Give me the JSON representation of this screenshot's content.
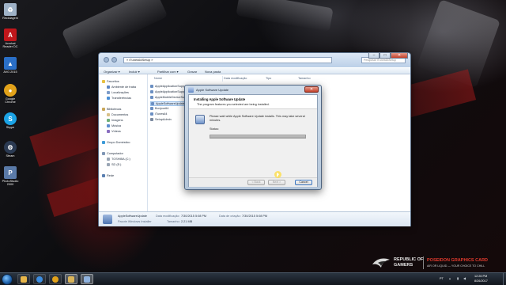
{
  "desktop": {
    "icons": [
      {
        "label": "Reciclagem",
        "color": "#9fb2c7"
      },
      {
        "label": "Acrobat Reader DC",
        "color": "#c0161b"
      },
      {
        "label": "AVG 2015",
        "color": "#2a6fc7"
      },
      {
        "label": "Google Chrome",
        "color": "#e2a21a"
      },
      {
        "label": "Skype",
        "color": "#1ba3e5"
      },
      {
        "label": "Steam",
        "color": "#2b3a52"
      },
      {
        "label": "PhotoStudio 2000",
        "color": "#5a7aa8"
      }
    ],
    "brand": {
      "rog_line1": "REPUBLIC OF",
      "rog_line2": "GAMERS",
      "product": "POSEIDON GRAPHICS CARD",
      "tagline": "AIR OR LIQUID — YOUR CHOICE TO CHILL"
    }
  },
  "explorer": {
    "address": "« iTunes64Setup »",
    "search_placeholder": "Pesquisar iTunes64Setup",
    "controls": {
      "minimize": "–",
      "maximize": "□",
      "close": "✕"
    },
    "toolbar": {
      "organize": "Organizar ▾",
      "include": "Incluir ▾",
      "share": "Partilhar com ▾",
      "burn": "Gravar",
      "new_folder": "Nova pasta"
    },
    "columns": {
      "name": "Nome",
      "date": "Data modificação",
      "type": "Tipo",
      "size": "Tamanho"
    },
    "nav": {
      "favorites": "Favoritos",
      "desktop": "Ambiente de traba",
      "places": "Localizações",
      "downloads": "Transferências",
      "libraries": "Bibliotecas",
      "documents": "Documentos",
      "images": "Imagens",
      "music": "Música",
      "videos": "Vídeos",
      "homegroup": "Grupo Doméstico",
      "computer": "Computador",
      "drive_c": "TOSHIBA (C:)",
      "drive_d": "SD (E:)",
      "network": "Rede"
    },
    "files": [
      {
        "name": "AppleApplicationSupp",
        "selected": false
      },
      {
        "name": "AppleApplicationSupp",
        "selected": false
      },
      {
        "name": "AppleMobileDeviceSup",
        "selected": false
      },
      {
        "name": "AppleSoftwareUpdate",
        "selected": true
      },
      {
        "name": "Bonjour64",
        "selected": false
      },
      {
        "name": "iTunes64",
        "selected": false
      },
      {
        "name": "SetupAdmin",
        "selected": false
      }
    ],
    "details": {
      "name": "AppleSoftwareUpdate",
      "type": "Pacote Windows Installer",
      "modified_label": "Data modificação:",
      "modified": "7/30/2015 5:08 PM",
      "created_label": "Data de criação:",
      "created": "7/30/2015 5:08 PM",
      "size_label": "Tamanho:",
      "size": "2.21 MB"
    }
  },
  "dialog": {
    "title": "Apple Software Update",
    "close": "✕",
    "heading": "Installing Apple Software Update",
    "subheading": "The program features you selected are being installed.",
    "message": "Please wait while Apple Software Update installs. This may take several minutes.",
    "status_label": "Status:",
    "progress": 1.0,
    "buttons": {
      "back": "< Back",
      "next": "Next >",
      "cancel": "Cancel"
    }
  },
  "taskbar": {
    "apps": [
      {
        "name": "explorer",
        "color": "#e7b64a",
        "active": false
      },
      {
        "name": "media-player",
        "color": "#3c8de0",
        "active": false
      },
      {
        "name": "chrome",
        "color": "#e2a21a",
        "active": false
      },
      {
        "name": "explorer-window",
        "color": "#d9b45a",
        "active": true
      },
      {
        "name": "installer",
        "color": "#8fb2de",
        "active": true
      }
    ],
    "language": "PT",
    "time": "12:26 PM",
    "date": "8/26/2017"
  }
}
